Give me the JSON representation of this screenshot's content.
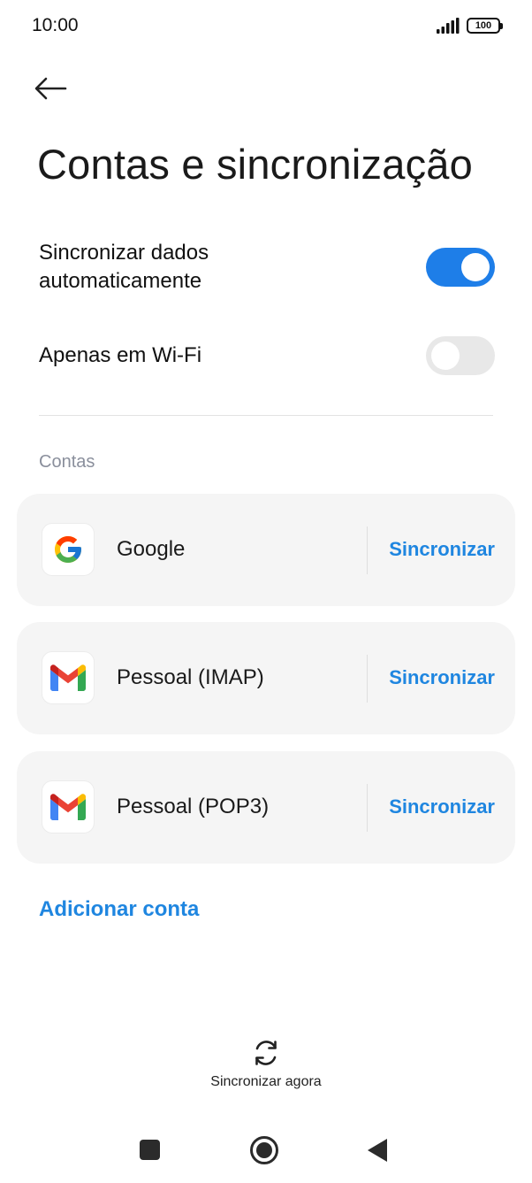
{
  "status_bar": {
    "time": "10:00",
    "battery": "100",
    "icons": [
      "signal-icon",
      "battery-icon"
    ]
  },
  "header": {
    "back_icon": "arrow-left-icon",
    "title": "Contas e sincronização"
  },
  "settings": {
    "auto_sync": {
      "label": "Sincronizar dados\nautomaticamente",
      "enabled": true
    },
    "wifi_only": {
      "label": "Apenas em Wi-Fi",
      "enabled": false
    }
  },
  "accounts_section": {
    "header": "Contas",
    "items": [
      {
        "name": "Google",
        "icon": "google-icon",
        "action": "Sincronizar"
      },
      {
        "name": "Pessoal (IMAP)",
        "icon": "gmail-icon",
        "action": "Sincronizar"
      },
      {
        "name": "Pessoal (POP3)",
        "icon": "gmail-icon",
        "action": "Sincronizar"
      }
    ],
    "add_account": "Adicionar conta"
  },
  "sync_now": {
    "label": "Sincronizar agora",
    "icon": "sync-icon"
  },
  "nav_bar": {
    "icons": [
      "recents-icon",
      "home-icon",
      "back-icon"
    ]
  },
  "colors": {
    "accent": "#1f86e0",
    "switch_on": "#1e7ee8",
    "switch_off": "#e8e8e8",
    "card_bg": "#f5f5f5",
    "section_header": "#8a8f9c"
  }
}
